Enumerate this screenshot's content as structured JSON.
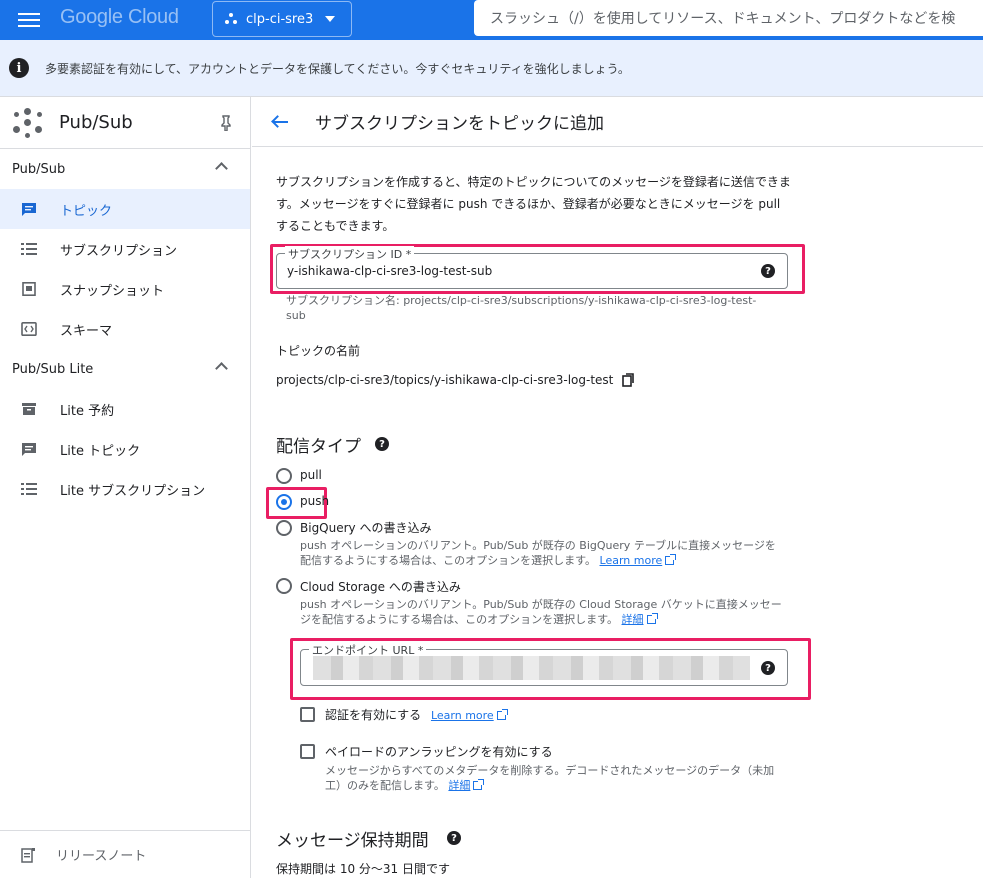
{
  "topbar": {
    "logo": "Google Cloud",
    "project": "clp-ci-sre3",
    "search_placeholder": "スラッシュ（/）を使用してリソース、ドキュメント、プロダクトなどを検"
  },
  "banner": {
    "text": "多要素認証を有効にして、アカウントとデータを保護してください。今すぐセキュリティを強化しましょう。"
  },
  "sidebar": {
    "title": "Pub/Sub",
    "sections": [
      {
        "label": "Pub/Sub",
        "items": [
          {
            "label": "トピック",
            "icon": "message-icon",
            "active": true
          },
          {
            "label": "サブスクリプション",
            "icon": "list-icon"
          },
          {
            "label": "スナップショット",
            "icon": "snapshot-icon"
          },
          {
            "label": "スキーマ",
            "icon": "code-icon"
          }
        ]
      },
      {
        "label": "Pub/Sub Lite",
        "items": [
          {
            "label": "Lite 予約",
            "icon": "reservation-icon"
          },
          {
            "label": "Lite トピック",
            "icon": "message-icon"
          },
          {
            "label": "Lite サブスクリプション",
            "icon": "list-icon"
          }
        ]
      }
    ],
    "footer": "リリースノート"
  },
  "main": {
    "title": "サブスクリプションをトピックに追加",
    "description": "サブスクリプションを作成すると、特定のトピックについてのメッセージを登録者に送信できます。メッセージをすぐに登録者に push できるほか、登録者が必要なときにメッセージを pull することもできます。",
    "subscription_id": {
      "label": "サブスクリプション ID *",
      "value": "y-ishikawa-clp-ci-sre3-log-test-sub",
      "hint": "サブスクリプション名: projects/clp-ci-sre3/subscriptions/y-ishikawa-clp-ci-sre3-log-test-sub"
    },
    "topic": {
      "label": "トピックの名前",
      "value": "projects/clp-ci-sre3/topics/y-ishikawa-clp-ci-sre3-log-test"
    },
    "delivery": {
      "heading": "配信タイプ",
      "options": [
        {
          "label": "pull",
          "selected": false
        },
        {
          "label": "push",
          "selected": true
        },
        {
          "label": "BigQuery への書き込み",
          "selected": false,
          "description": "push オペレーションのバリアント。Pub/Sub が既存の BigQuery テーブルに直接メッセージを配信するようにする場合は、このオプションを選択します。",
          "link": "Learn more"
        },
        {
          "label": "Cloud Storage への書き込み",
          "selected": false,
          "description": "push オペレーションのバリアント。Pub/Sub が既存の Cloud Storage バケットに直接メッセージを配信するようにする場合は、このオプションを選択します。",
          "link": "詳細"
        }
      ]
    },
    "endpoint": {
      "label": "エンドポイント URL *"
    },
    "auth": {
      "label": "認証を有効にする",
      "link": "Learn more",
      "checked": false
    },
    "unwrap": {
      "label": "ペイロードのアンラッピングを有効にする",
      "description": "メッセージからすべてのメタデータを削除する。デコードされたメッセージのデータ（未加工）のみを配信します。",
      "link": "詳細",
      "checked": false
    },
    "retention": {
      "heading": "メッセージ保持期間",
      "text": "保持期間は 10 分〜31 日間です"
    }
  },
  "colors": {
    "accent": "#1a73e8",
    "highlight": "#e91e63",
    "banner": "#e8f0fe"
  }
}
